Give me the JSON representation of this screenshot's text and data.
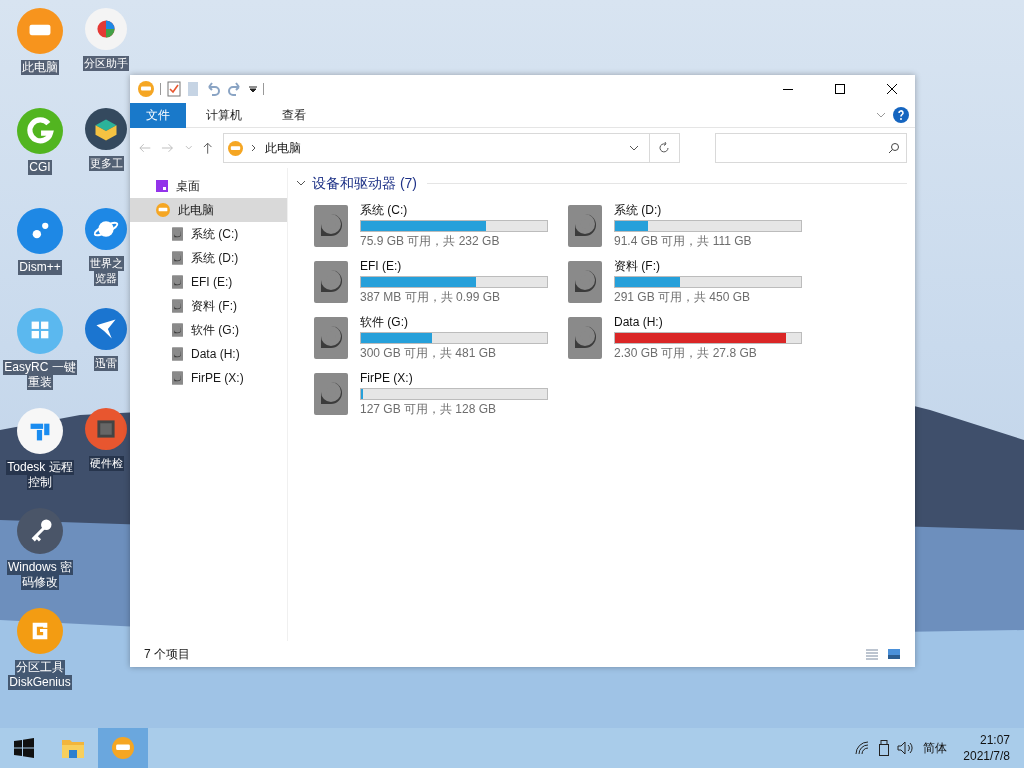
{
  "desktop_icon_columns": [
    [
      {
        "kind": "computer",
        "lines": [
          "此电脑"
        ]
      },
      {
        "kind": "cgi",
        "lines": [
          "CGI"
        ]
      },
      {
        "kind": "dism",
        "lines": [
          "Dism++"
        ]
      },
      {
        "kind": "easyrc",
        "lines": [
          "EasyRC 一键",
          "重装"
        ]
      },
      {
        "kind": "todesk",
        "lines": [
          "Todesk 远程",
          "控制"
        ]
      },
      {
        "kind": "key",
        "lines": [
          "Windows 密",
          "码修改"
        ]
      },
      {
        "kind": "diskgenius",
        "lines": [
          "分区工具",
          "DiskGenius"
        ]
      }
    ],
    [
      {
        "kind": "partition",
        "lines": [
          "分区助手"
        ]
      },
      {
        "kind": "toolbox",
        "lines": [
          "更多工"
        ]
      },
      {
        "kind": "browser",
        "lines": [
          "世界之",
          "览器"
        ]
      },
      {
        "kind": "thunder",
        "lines": [
          "迅雷"
        ]
      },
      {
        "kind": "hardware",
        "lines": [
          "硬件检"
        ]
      }
    ]
  ],
  "window": {
    "ribbon_tabs": [
      {
        "label": "文件",
        "selected": true
      },
      {
        "label": "计算机",
        "selected": false
      },
      {
        "label": "查看",
        "selected": false
      }
    ],
    "address": "此电脑",
    "sidebar": {
      "items": [
        {
          "kind": "desktop",
          "label": "桌面",
          "selected": false
        },
        {
          "kind": "computer",
          "label": "此电脑",
          "selected": true,
          "children": [
            {
              "kind": "drive",
              "label": "系统 (C:)",
              "selected": false
            },
            {
              "kind": "drive",
              "label": "系统 (D:)",
              "selected": false
            },
            {
              "kind": "drive",
              "label": "EFI (E:)",
              "selected": false
            },
            {
              "kind": "drive",
              "label": "资料 (F:)",
              "selected": false
            },
            {
              "kind": "drive",
              "label": "软件 (G:)",
              "selected": false
            },
            {
              "kind": "drive",
              "label": "Data (H:)",
              "selected": false
            },
            {
              "kind": "drive",
              "label": "FirPE (X:)",
              "selected": false
            }
          ]
        }
      ]
    },
    "group": {
      "title": "设备和驱动器 (7)",
      "expanded": true
    },
    "drives": [
      {
        "name": "系统 (C:)",
        "level": 0.67,
        "color": "#26a0da",
        "detail": "75.9 GB 可用，共 232 GB"
      },
      {
        "name": "系统 (D:)",
        "level": 0.18,
        "color": "#26a0da",
        "detail": "91.4 GB 可用，共 111 GB"
      },
      {
        "name": "EFI (E:)",
        "level": 0.62,
        "color": "#26a0da",
        "detail": "387 MB 可用，共 0.99 GB"
      },
      {
        "name": "资料 (F:)",
        "level": 0.35,
        "color": "#26a0da",
        "detail": "291 GB 可用，共 450 GB"
      },
      {
        "name": "软件 (G:)",
        "level": 0.38,
        "color": "#26a0da",
        "detail": "300 GB 可用，共 481 GB"
      },
      {
        "name": "Data (H:)",
        "level": 0.92,
        "color": "#da2626",
        "detail": "2.30 GB 可用，共 27.8 GB"
      },
      {
        "name": "FirPE (X:)",
        "level": 0.01,
        "color": "#26a0da",
        "detail": "127 GB 可用，共 128 GB"
      }
    ],
    "status_bar": {
      "count": "7 个项目"
    }
  },
  "taskbar": {
    "apps": [
      {
        "kind": "explorer",
        "selected": false
      },
      {
        "kind": "computer",
        "selected": true
      }
    ],
    "ime": "简体",
    "time": "21:07",
    "date": "2021/7/8"
  }
}
